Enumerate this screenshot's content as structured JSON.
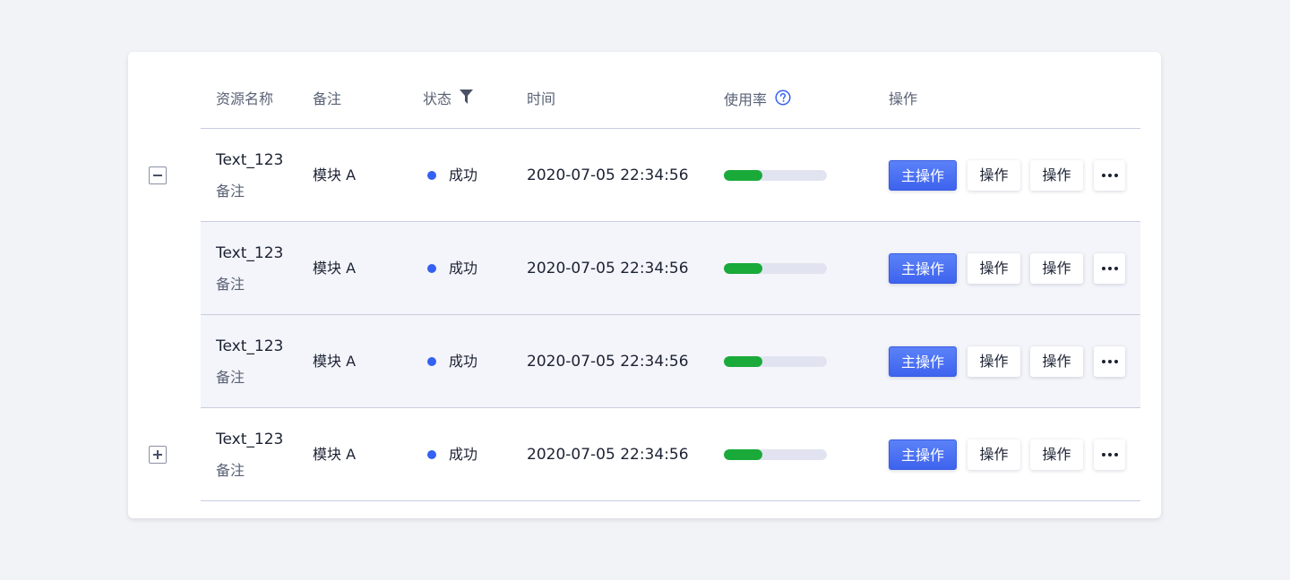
{
  "columns": {
    "name": "资源名称",
    "note": "备注",
    "status": "状态",
    "time": "时间",
    "usage": "使用率",
    "actions": "操作"
  },
  "rows": [
    {
      "name": "Text_123",
      "sub": "备注",
      "module": "模块 A",
      "status": "成功",
      "time": "2020-07-05 22:34:56",
      "usage": 0.37,
      "primary": "主操作",
      "op1": "操作",
      "op2": "操作",
      "expander": "collapse"
    },
    {
      "name": "Text_123",
      "sub": "备注",
      "module": "模块 A",
      "status": "成功",
      "time": "2020-07-05 22:34:56",
      "usage": 0.37,
      "primary": "主操作",
      "op1": "操作",
      "op2": "操作"
    },
    {
      "name": "Text_123",
      "sub": "备注",
      "module": "模块 A",
      "status": "成功",
      "time": "2020-07-05 22:34:56",
      "usage": 0.37,
      "primary": "主操作",
      "op1": "操作",
      "op2": "操作"
    },
    {
      "name": "Text_123",
      "sub": "备注",
      "module": "模块 A",
      "status": "成功",
      "time": "2020-07-05 22:34:56",
      "usage": 0.37,
      "primary": "主操作",
      "op1": "操作",
      "op2": "操作",
      "expander": "expand"
    }
  ],
  "colors": {
    "status_dot": "#3561f2",
    "usage_fill": "#1aaa3a",
    "primary_button": "#4a6ff3"
  },
  "icons": {
    "filter": "filter-icon",
    "help": "help-circle-icon",
    "more": "more-horizontal-icon",
    "collapse": "minus-square-icon",
    "expand": "plus-square-icon"
  }
}
